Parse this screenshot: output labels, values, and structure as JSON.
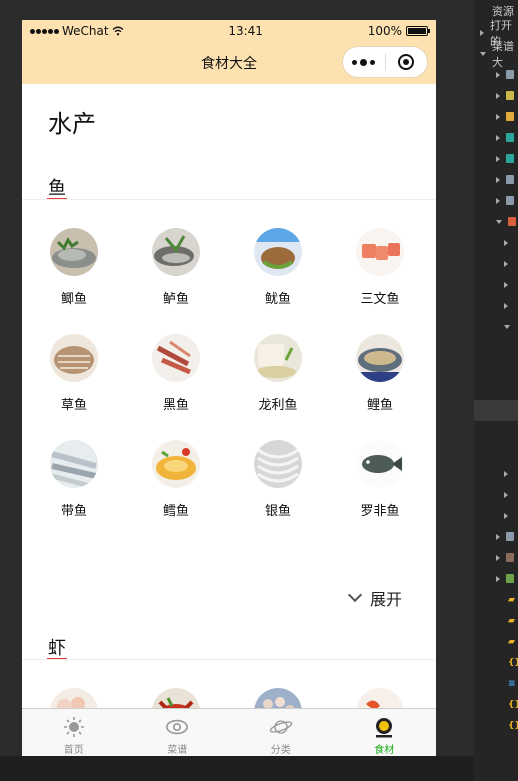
{
  "status": {
    "carrier": "WeChat",
    "time": "13:41",
    "battery": "100%"
  },
  "navbar": {
    "title": "食材大全"
  },
  "page": {
    "title": "水产"
  },
  "sections": [
    {
      "title": "鱼",
      "items": [
        {
          "label": "鲫鱼"
        },
        {
          "label": "鲈鱼"
        },
        {
          "label": "鱿鱼"
        },
        {
          "label": "三文鱼"
        },
        {
          "label": "草鱼"
        },
        {
          "label": "黑鱼"
        },
        {
          "label": "龙利鱼"
        },
        {
          "label": "鲤鱼"
        },
        {
          "label": "带鱼"
        },
        {
          "label": "鳕鱼"
        },
        {
          "label": "银鱼"
        },
        {
          "label": "罗非鱼"
        }
      ],
      "expand_label": "展开"
    },
    {
      "title": "虾"
    }
  ],
  "tabbar": {
    "tabs": [
      {
        "label": "首页"
      },
      {
        "label": "菜谱"
      },
      {
        "label": "分类"
      },
      {
        "label": "食材"
      }
    ],
    "active_index": 3
  },
  "devtools": {
    "header": "资源",
    "rows": [
      {
        "label": "打开的"
      },
      {
        "label": "菜谱大"
      }
    ]
  },
  "colors": {
    "accent": "#fde1b0",
    "active_tab": "#1aad19",
    "underline": "#e4393c"
  }
}
